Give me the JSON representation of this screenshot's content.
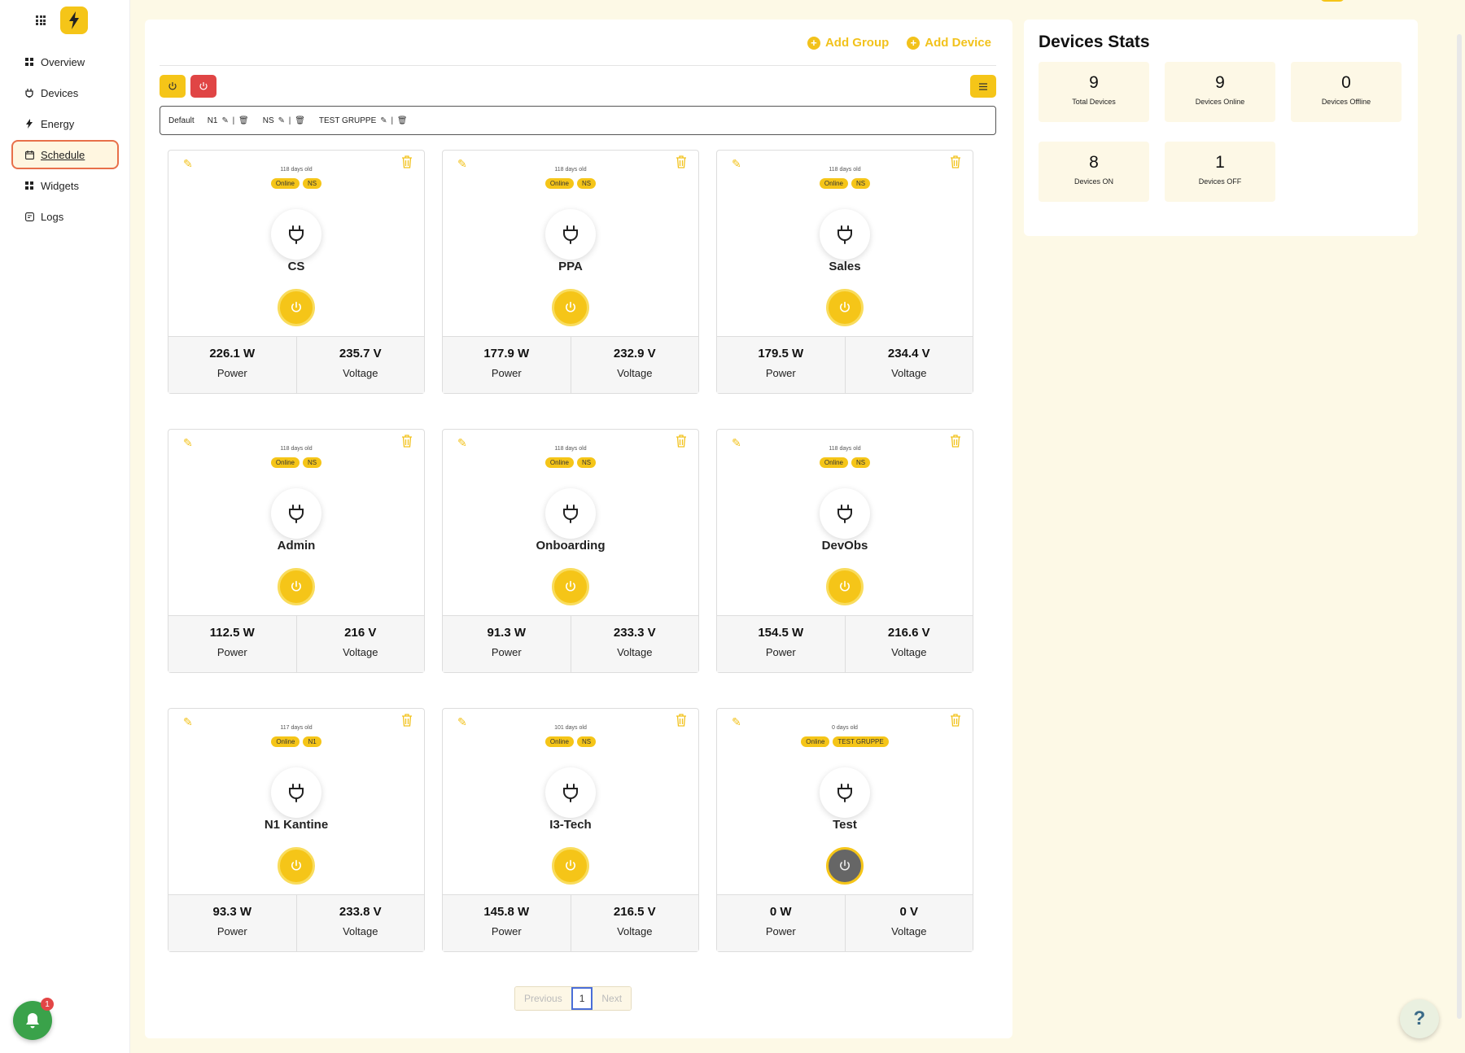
{
  "nav": {
    "items": [
      {
        "label": "Overview",
        "icon": "grid-icon"
      },
      {
        "label": "Devices",
        "icon": "plug-icon"
      },
      {
        "label": "Energy",
        "icon": "lightning-icon"
      },
      {
        "label": "Schedule",
        "icon": "calendar-icon",
        "active": true
      },
      {
        "label": "Widgets",
        "icon": "grid-icon"
      },
      {
        "label": "Logs",
        "icon": "log-icon"
      }
    ]
  },
  "notifications": {
    "count": "1"
  },
  "toolbar": {
    "add_group": "Add Group",
    "add_device": "Add Device"
  },
  "groups": [
    {
      "name": "Default",
      "editable": false
    },
    {
      "name": "N1",
      "editable": true
    },
    {
      "name": "NS",
      "editable": true
    },
    {
      "name": "TEST GRUPPE",
      "editable": true
    }
  ],
  "devices": [
    {
      "name": "CS",
      "age": "118 days old",
      "status": "Online",
      "group": "NS",
      "power": "226.1 W",
      "voltage": "235.7 V",
      "on": true
    },
    {
      "name": "PPA",
      "age": "118 days old",
      "status": "Online",
      "group": "NS",
      "power": "177.9 W",
      "voltage": "232.9 V",
      "on": true
    },
    {
      "name": "Sales",
      "age": "118 days old",
      "status": "Online",
      "group": "NS",
      "power": "179.5 W",
      "voltage": "234.4 V",
      "on": true
    },
    {
      "name": "Admin",
      "age": "118 days old",
      "status": "Online",
      "group": "NS",
      "power": "112.5 W",
      "voltage": "216 V",
      "on": true
    },
    {
      "name": "Onboarding",
      "age": "118 days old",
      "status": "Online",
      "group": "NS",
      "power": "91.3 W",
      "voltage": "233.3 V",
      "on": true
    },
    {
      "name": "DevObs",
      "age": "118 days old",
      "status": "Online",
      "group": "NS",
      "power": "154.5 W",
      "voltage": "216.6 V",
      "on": true
    },
    {
      "name": "N1 Kantine",
      "age": "117 days old",
      "status": "Online",
      "group": "N1",
      "power": "93.3 W",
      "voltage": "233.8 V",
      "on": true
    },
    {
      "name": "I3-Tech",
      "age": "101 days old",
      "status": "Online",
      "group": "NS",
      "power": "145.8 W",
      "voltage": "216.5 V",
      "on": true
    },
    {
      "name": "Test",
      "age": "0 days old",
      "status": "Online",
      "group": "TEST GRUPPE",
      "power": "0 W",
      "voltage": "0 V",
      "on": false
    }
  ],
  "labels": {
    "power": "Power",
    "voltage": "Voltage"
  },
  "pagination": {
    "previous": "Previous",
    "current": "1",
    "next": "Next"
  },
  "stats": {
    "title": "Devices Stats",
    "items": [
      {
        "value": "9",
        "label": "Total Devices"
      },
      {
        "value": "9",
        "label": "Devices Online"
      },
      {
        "value": "0",
        "label": "Devices Offline"
      },
      {
        "value": "8",
        "label": "Devices ON"
      },
      {
        "value": "1",
        "label": "Devices OFF"
      }
    ]
  },
  "help": {
    "label": "?"
  },
  "colors": {
    "accent": "#f5c518",
    "danger": "#e04545",
    "active_outline": "#e8704a"
  }
}
